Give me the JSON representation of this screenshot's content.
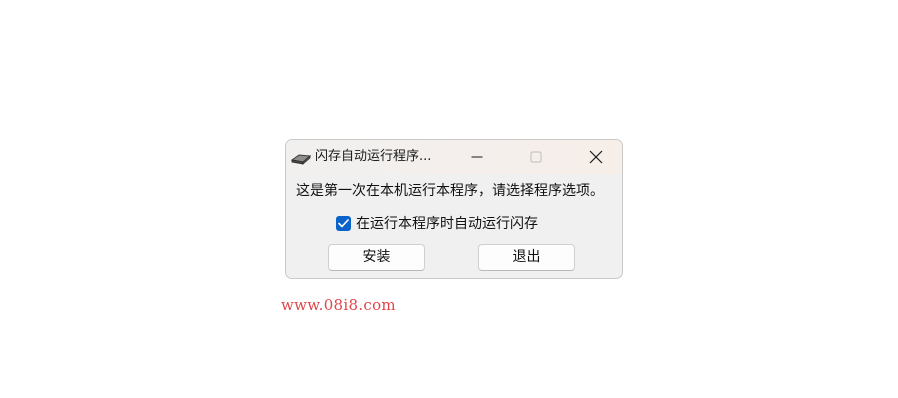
{
  "dialog": {
    "title": "闪存自动运行程序...",
    "message": "这是第一次在本机运行本程序，请选择程序选项。",
    "checkbox": {
      "label": "在运行本程序时自动运行闪存",
      "checked": true
    },
    "buttons": {
      "install": "安装",
      "exit": "退出"
    },
    "icons": {
      "app": "flash-drive-icon",
      "minimize": "minimize-icon",
      "maximize": "maximize-icon",
      "close": "close-icon",
      "check": "checkmark-icon"
    }
  },
  "watermark": "www.08i8.com",
  "colors": {
    "accent": "#0a63c9",
    "watermark": "#e0454a"
  }
}
